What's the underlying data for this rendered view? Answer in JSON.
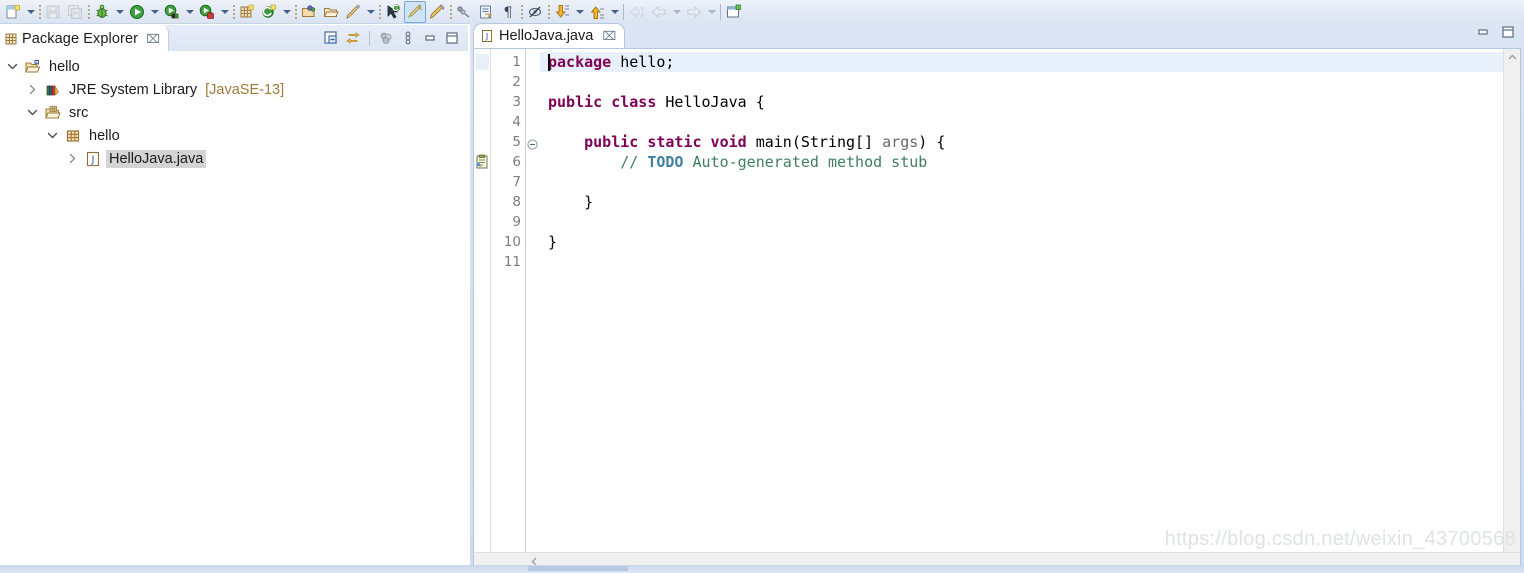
{
  "app": {
    "title": "Eclipse IDE - Java Editor"
  },
  "toolbar": {
    "items": [
      {
        "name": "new-wizard-button",
        "icon": "new-file-icon",
        "label": "New",
        "dropdown": true,
        "enabled": true
      },
      {
        "name": "sep",
        "icon": "separator-dots",
        "label": "",
        "dropdown": false,
        "enabled": true
      },
      {
        "name": "save-button",
        "icon": "save-icon",
        "label": "Save",
        "dropdown": false,
        "enabled": false
      },
      {
        "name": "save-all-button",
        "icon": "save-all-icon",
        "label": "Save All",
        "dropdown": false,
        "enabled": false
      },
      {
        "name": "sep",
        "icon": "separator-dots",
        "label": "",
        "dropdown": false,
        "enabled": true
      },
      {
        "name": "debug-button",
        "icon": "debug-bug-icon",
        "label": "Debug",
        "dropdown": true,
        "enabled": true
      },
      {
        "name": "run-button",
        "icon": "run-play-icon",
        "label": "Run",
        "dropdown": true,
        "enabled": true
      },
      {
        "name": "coverage-button",
        "icon": "coverage-icon",
        "label": "Coverage As",
        "dropdown": true,
        "enabled": true
      },
      {
        "name": "run-external-button",
        "icon": "run-external-tools-icon",
        "label": "External Tools",
        "dropdown": true,
        "enabled": true
      },
      {
        "name": "sep",
        "icon": "separator-dots",
        "label": "",
        "dropdown": false,
        "enabled": true
      },
      {
        "name": "new-java-package-button",
        "icon": "new-package-icon",
        "label": "New Java Package",
        "dropdown": false,
        "enabled": true
      },
      {
        "name": "new-class-button",
        "icon": "new-class-icon",
        "label": "New Java Class",
        "dropdown": true,
        "enabled": true
      },
      {
        "name": "sep",
        "icon": "separator-dots",
        "label": "",
        "dropdown": false,
        "enabled": true
      },
      {
        "name": "open-type-button",
        "icon": "open-type-icon",
        "label": "Open Type",
        "dropdown": false,
        "enabled": true
      },
      {
        "name": "open-task-button",
        "icon": "open-task-icon",
        "label": "Open Task",
        "dropdown": false,
        "enabled": true
      },
      {
        "name": "quick-fix-button",
        "icon": "quick-fix-pencil-icon",
        "label": "Quick Fix",
        "dropdown": true,
        "enabled": true
      },
      {
        "name": "sep",
        "icon": "separator-dots",
        "label": "",
        "dropdown": false,
        "enabled": true
      },
      {
        "name": "search-button",
        "icon": "search-java-icon",
        "label": "Search",
        "dropdown": false,
        "enabled": true
      },
      {
        "name": "skip-breakpoints-button",
        "icon": "skip-all-breakpoints-icon",
        "label": "Skip All Breakpoints",
        "dropdown": false,
        "enabled": true,
        "active": true
      },
      {
        "name": "toggle-mark-occurrences-button",
        "icon": "mark-occurrences-icon",
        "label": "Toggle Mark Occurrences",
        "dropdown": false,
        "enabled": true
      },
      {
        "name": "sep",
        "icon": "separator-dots",
        "label": "",
        "dropdown": false,
        "enabled": true
      },
      {
        "name": "next-annotation-button",
        "icon": "next-annotation-icon",
        "label": "Next Annotation",
        "dropdown": false,
        "enabled": true
      },
      {
        "name": "previous-annotation-button",
        "icon": "previous-annotation-icon",
        "label": "Previous Annotation",
        "dropdown": false,
        "enabled": true
      },
      {
        "name": "show-whitespace-button",
        "icon": "pilcrow-icon",
        "label": "Show Whitespace Characters",
        "dropdown": false,
        "enabled": true
      },
      {
        "name": "sep",
        "icon": "separator-dots",
        "label": "",
        "dropdown": false,
        "enabled": true
      },
      {
        "name": "toggle-block-selection-button",
        "icon": "block-selection-icon",
        "label": "Toggle Block Selection",
        "dropdown": false,
        "enabled": true
      },
      {
        "name": "sep",
        "icon": "separator-dots",
        "label": "",
        "dropdown": false,
        "enabled": true
      },
      {
        "name": "step-into-button",
        "icon": "down-arrow-icon",
        "label": "Step Into",
        "dropdown": true,
        "enabled": true
      },
      {
        "name": "step-return-button",
        "icon": "up-arrow-icon",
        "label": "Step Return",
        "dropdown": true,
        "enabled": true
      },
      {
        "name": "sep",
        "icon": "separator-line",
        "label": "",
        "dropdown": false,
        "enabled": true
      },
      {
        "name": "back-to-button",
        "icon": "back-to-icon",
        "label": "Back To",
        "dropdown": false,
        "enabled": false
      },
      {
        "name": "back-button",
        "icon": "back-arrow-icon",
        "label": "Back",
        "dropdown": true,
        "enabled": false
      },
      {
        "name": "forward-button",
        "icon": "forward-arrow-icon",
        "label": "Forward",
        "dropdown": true,
        "enabled": false
      },
      {
        "name": "sep",
        "icon": "separator-line",
        "label": "",
        "dropdown": false,
        "enabled": true
      },
      {
        "name": "new-window-button",
        "icon": "new-window-icon",
        "label": "New Window",
        "dropdown": false,
        "enabled": true
      }
    ]
  },
  "package_explorer": {
    "tab": {
      "label": "Package Explorer",
      "icon": "package-explorer-icon",
      "close_glyph": "⌧"
    },
    "view_toolbar": [
      {
        "name": "collapse-all-button",
        "icon": "collapse-all-icon",
        "label": "Collapse All"
      },
      {
        "name": "link-with-editor-button",
        "icon": "link-with-editor-icon",
        "label": "Link with Editor"
      },
      {
        "name": "view-filters-button",
        "icon": "view-filters-icon",
        "label": "View Menu Filters"
      },
      {
        "name": "view-menu-button",
        "icon": "view-menu-icon",
        "label": "View Menu"
      },
      {
        "name": "minimize-view-button",
        "icon": "minimize-icon",
        "label": "Minimize"
      },
      {
        "name": "maximize-view-button",
        "icon": "maximize-icon",
        "label": "Maximize"
      }
    ],
    "tree": [
      {
        "name": "tree-item-project-hello",
        "label": "hello",
        "sub_label": "",
        "icon": "java-project-icon",
        "twisty": "expanded",
        "depth": 0,
        "selected": false
      },
      {
        "name": "tree-item-jre-system-library",
        "label": "JRE System Library",
        "sub_label": "[JavaSE-13]",
        "icon": "jre-library-icon",
        "twisty": "collapsed",
        "depth": 1,
        "selected": false
      },
      {
        "name": "tree-item-source-folder-src",
        "label": "src",
        "sub_label": "",
        "icon": "source-folder-icon",
        "twisty": "expanded",
        "depth": 1,
        "selected": false
      },
      {
        "name": "tree-item-package-hello",
        "label": "hello",
        "sub_label": "",
        "icon": "package-icon",
        "twisty": "expanded",
        "depth": 2,
        "selected": false
      },
      {
        "name": "tree-item-file-hellojava",
        "label": "HelloJava.java",
        "sub_label": "",
        "icon": "java-compilation-unit-icon",
        "twisty": "collapsed",
        "depth": 3,
        "selected": true
      }
    ]
  },
  "editor": {
    "tab": {
      "label": "HelloJava.java",
      "icon": "java-file-icon",
      "close_glyph": "⌧"
    },
    "window_buttons": [
      {
        "name": "minimize-editor-button",
        "icon": "minimize-icon",
        "label": "Minimize"
      },
      {
        "name": "maximize-editor-button",
        "icon": "maximize-icon",
        "label": "Maximize"
      }
    ],
    "gutter": {
      "line_numbers": [
        "1",
        "2",
        "3",
        "4",
        "5",
        "6",
        "7",
        "8",
        "9",
        "10",
        "11"
      ],
      "markers": [
        {
          "line": 1,
          "name": "changed-lines-marker",
          "icon": "diff-hatch-icon"
        },
        {
          "line": 6,
          "name": "todo-task-marker",
          "icon": "task-todo-icon"
        }
      ],
      "folding": [
        {
          "line": 5,
          "name": "fold-toggle",
          "icon": "collapse-minus-icon",
          "state": "expanded"
        }
      ]
    },
    "caret": {
      "line": 1,
      "column": 1
    },
    "highlighted_line": 1,
    "code_lines": [
      {
        "number": 1,
        "tokens": [
          {
            "text": "package",
            "type": "keyword"
          },
          {
            "text": " hello;",
            "type": "plain"
          }
        ]
      },
      {
        "number": 2,
        "tokens": []
      },
      {
        "number": 3,
        "tokens": [
          {
            "text": "public class",
            "type": "keyword"
          },
          {
            "text": " HelloJava {",
            "type": "plain"
          }
        ]
      },
      {
        "number": 4,
        "tokens": []
      },
      {
        "number": 5,
        "tokens": [
          {
            "text": "    ",
            "type": "plain"
          },
          {
            "text": "public static void",
            "type": "keyword"
          },
          {
            "text": " main(String[] ",
            "type": "plain"
          },
          {
            "text": "args",
            "type": "param"
          },
          {
            "text": ") {",
            "type": "plain"
          }
        ]
      },
      {
        "number": 6,
        "tokens": [
          {
            "text": "        // ",
            "type": "comment"
          },
          {
            "text": "TODO",
            "type": "todo"
          },
          {
            "text": " Auto-generated method stub",
            "type": "comment"
          }
        ]
      },
      {
        "number": 7,
        "tokens": []
      },
      {
        "number": 8,
        "tokens": [
          {
            "text": "    }",
            "type": "plain"
          }
        ]
      },
      {
        "number": 9,
        "tokens": []
      },
      {
        "number": 10,
        "tokens": [
          {
            "text": "}",
            "type": "plain"
          }
        ]
      },
      {
        "number": 11,
        "tokens": []
      }
    ],
    "scrollbars": {
      "vertical": {
        "name": "editor-vertical-scrollbar",
        "up_glyph": "∧",
        "down_glyph": "∨"
      },
      "horizontal": {
        "name": "editor-horizontal-scrollbar",
        "left_glyph": "‹"
      }
    }
  },
  "watermark": {
    "text": "https://blog.csdn.net/weixin_43700568"
  },
  "colors": {
    "keyword": "#7f0055",
    "comment": "#3f7f5f",
    "todo": "#3f7f9f",
    "param": "#6a6a6a",
    "selection": "#d4d4d4",
    "line_highlight": "#e8f0fc",
    "chrome": "#dbe4f2",
    "sub_label": "#a07a3c"
  }
}
